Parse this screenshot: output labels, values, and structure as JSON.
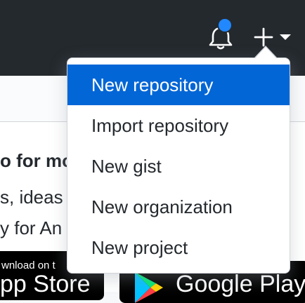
{
  "header": {
    "notification_icon": "bell-icon",
    "notification_indicator_color": "#2188ff",
    "create_icon": "plus-icon",
    "create_caret_icon": "caret-down-icon"
  },
  "background": {
    "heading_fragment": "o for mo",
    "line2_fragment": "s, ideas",
    "line3_fragment": "y for An"
  },
  "badges": {
    "appstore_small": "wnload on t",
    "appstore_big": "pp Store",
    "gplay_big": "Google Play"
  },
  "dropdown": {
    "items": [
      {
        "label": "New repository",
        "active": true
      },
      {
        "label": "Import repository",
        "active": false
      },
      {
        "label": "New gist",
        "active": false
      },
      {
        "label": "New organization",
        "active": false
      },
      {
        "label": "New project",
        "active": false
      }
    ],
    "active_color": "#0366d6"
  }
}
